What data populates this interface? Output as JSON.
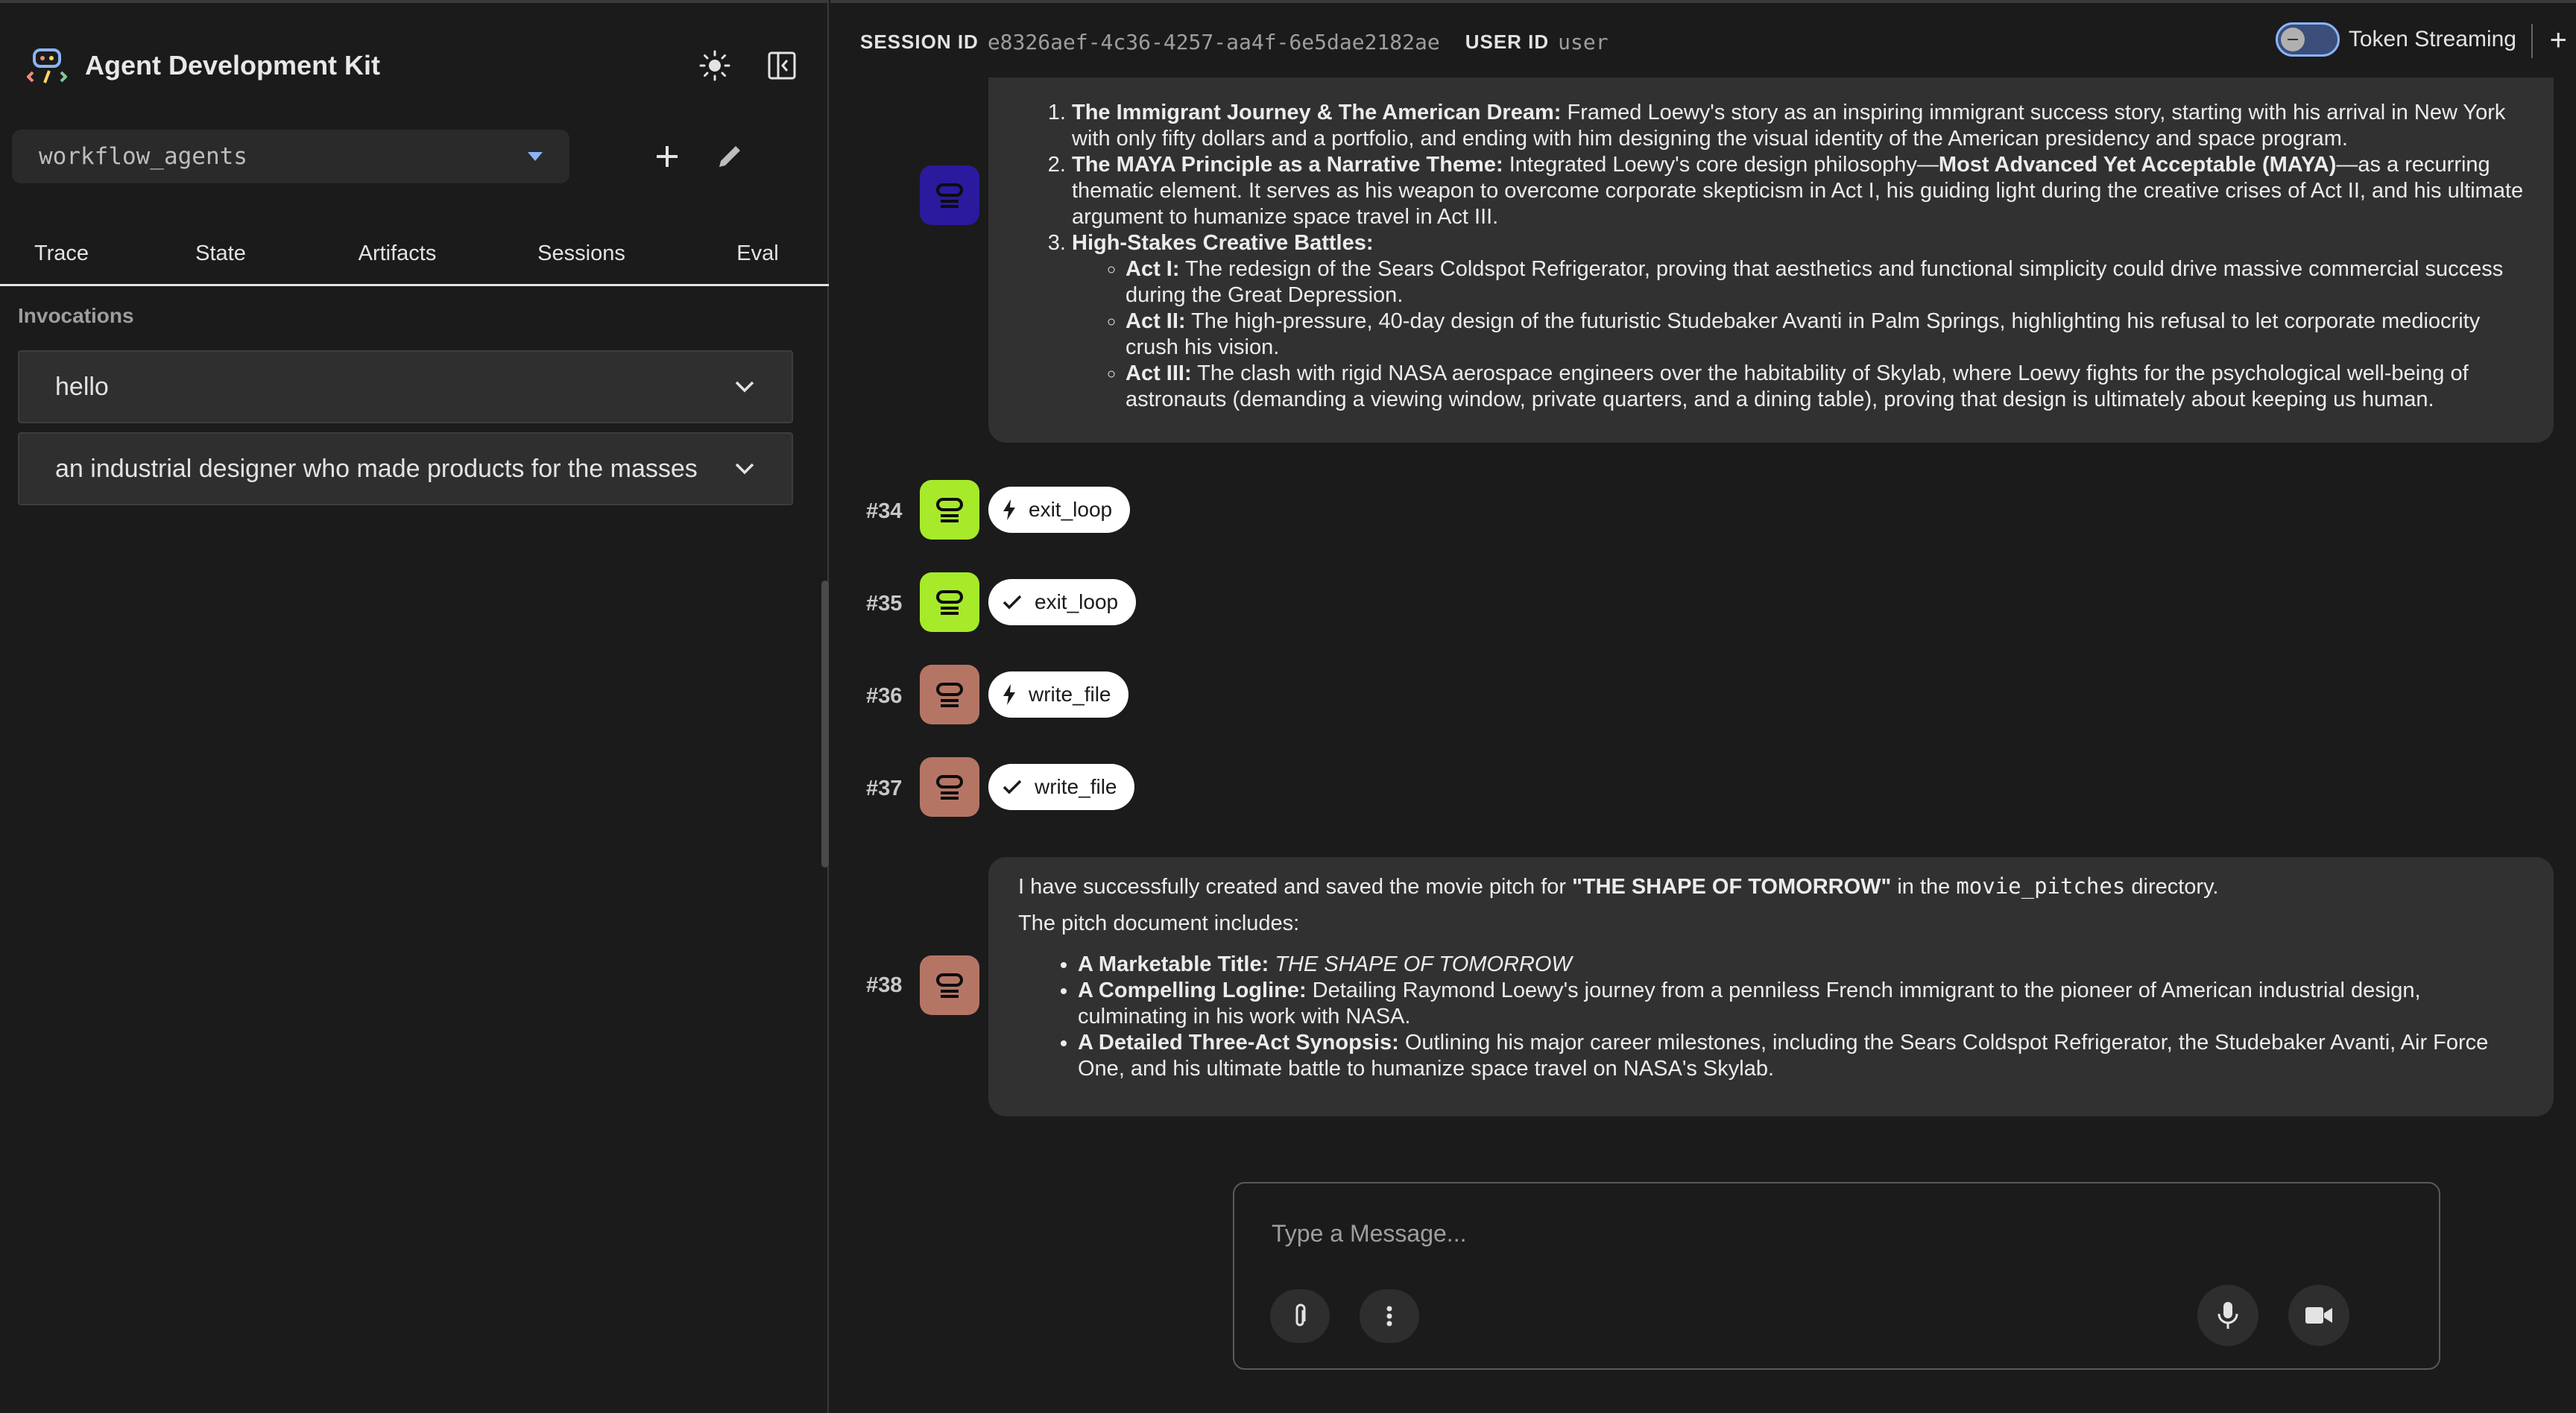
{
  "app": {
    "title": "Agent Development Kit",
    "agent_select_value": "workflow_agents"
  },
  "sidebar": {
    "tabs": [
      "Trace",
      "State",
      "Artifacts",
      "Sessions",
      "Eval"
    ],
    "invocations_title": "Invocations",
    "invocations": [
      "hello",
      "an industrial designer who made products for the masses"
    ]
  },
  "header": {
    "session_label": "SESSION ID",
    "session_id": "e8326aef-4c36-4257-aa4f-6e5dae2182ae",
    "user_label": "USER ID",
    "user_id": "user",
    "token_streaming_label": "Token Streaming",
    "new_session_icon": "+"
  },
  "prev_message": {
    "items": [
      {
        "title": "The Immigrant Journey & The American Dream:",
        "text": " Framed Loewy's story as an inspiring immigrant success story, starting with his arrival in New York with only fifty dollars and a portfolio, and ending with him designing the visual identity of the American presidency and space program."
      },
      {
        "title": "The MAYA Principle as a Narrative Theme:",
        "text": " Integrated Loewy's core design philosophy—",
        "bold2": "Most Advanced Yet Acceptable (MAYA)",
        "text2": "—as a recurring thematic element. It serves as his weapon to overcome corporate skepticism in Act I, his guiding light during the creative crises of Act II, and his ultimate argument to humanize space travel in Act III."
      },
      {
        "title": "High-Stakes Creative Battles:",
        "text": ""
      }
    ],
    "acts": [
      {
        "title": "Act I:",
        "text": " The redesign of the Sears Coldspot Refrigerator, proving that aesthetics and functional simplicity could drive massive commercial success during the Great Depression."
      },
      {
        "title": "Act II:",
        "text": " The high-pressure, 40-day design of the futuristic Studebaker Avanti in Palm Springs, highlighting his refusal to let corporate mediocrity crush his vision."
      },
      {
        "title": "Act III:",
        "text": " The clash with rigid NASA aerospace engineers over the habitability of Skylab, where Loewy fights for the psychological well-being of astronauts (demanding a viewing window, private quarters, and a dining table), proving that design is ultimately about keeping us human."
      }
    ]
  },
  "events": [
    {
      "num": "#34",
      "icon": "bolt-icon",
      "label": "exit_loop",
      "color": "#a6ea2a"
    },
    {
      "num": "#35",
      "icon": "check-icon",
      "label": "exit_loop",
      "color": "#a6ea2a"
    },
    {
      "num": "#36",
      "icon": "bolt-icon",
      "label": "write_file",
      "color": "#b57565"
    },
    {
      "num": "#37",
      "icon": "check-icon",
      "label": "write_file",
      "color": "#b57565"
    }
  ],
  "final_message": {
    "num": "#38",
    "intro_a": "I have successfully created and saved the movie pitch for ",
    "intro_title": "\"THE SHAPE OF TOMORROW\"",
    "intro_b": " in the ",
    "intro_dir": "movie_pitches",
    "intro_c": " directory.",
    "includes": "The pitch document includes:",
    "bullets": [
      {
        "title": "A Marketable Title:",
        "text": "THE SHAPE OF TOMORROW"
      },
      {
        "title": "A Compelling Logline:",
        "text": " Detailing Raymond Loewy's journey from a penniless French immigrant to the pioneer of American industrial design, culminating in his work with NASA."
      },
      {
        "title": "A Detailed Three-Act Synopsis:",
        "text": " Outlining his major career milestones, including the Sears Coldspot Refrigerator, the Studebaker Avanti, Air Force One, and his ultimate battle to humanize space travel on NASA's Skylab."
      }
    ]
  },
  "composer": {
    "placeholder": "Type a Message..."
  },
  "colors": {
    "avatar_blue": "#2a1a9e",
    "avatar_green": "#a6ea2a",
    "avatar_rust": "#b57565",
    "accent": "#8ab4f8"
  }
}
